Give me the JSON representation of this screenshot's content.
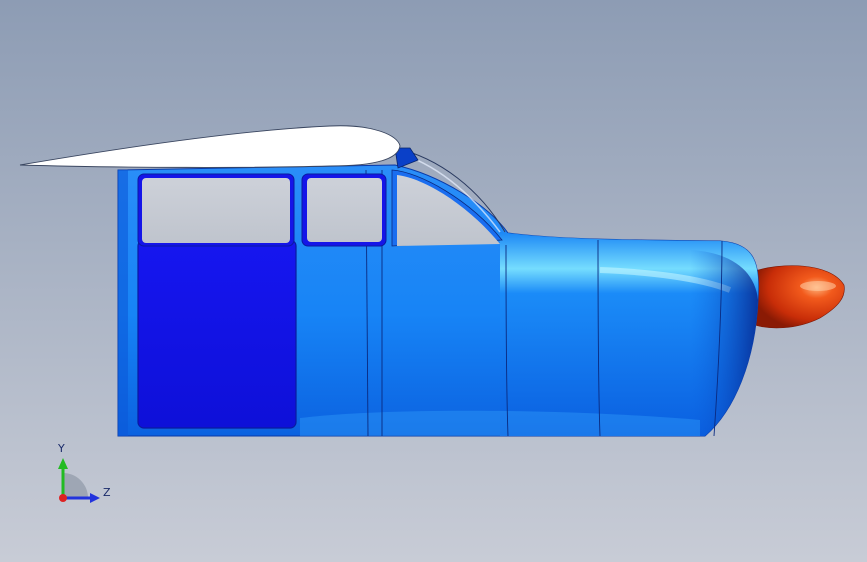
{
  "viewport": {
    "background_top": "#8e9db5",
    "background_bottom": "#c6cbd6"
  },
  "model": {
    "body_color": "#1a86f5",
    "door_panel_color": "#1414ee",
    "window_color": "#c6cbd4",
    "wing_color": "#ffffff",
    "spinner_color": "#e03a10"
  },
  "triad": {
    "y_label": "Y",
    "z_label": "Z",
    "y_color": "#22bb22",
    "z_color": "#2233dd",
    "x_color": "#dd2222"
  }
}
